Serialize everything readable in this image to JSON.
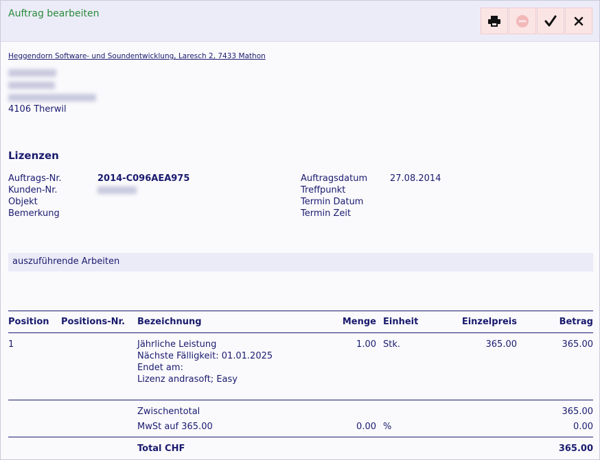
{
  "window": {
    "title": "Auftrag bearbeiten"
  },
  "toolbar": {
    "buttons": [
      {
        "icon": "print-icon"
      },
      {
        "icon": "no-entry-icon"
      },
      {
        "icon": "checkmark-icon"
      },
      {
        "icon": "close-icon"
      }
    ]
  },
  "company": {
    "address_line": "Heggendorn Software- und Soundentwicklung, Laresch 2, 7433 Mathon"
  },
  "recipient": {
    "city": "4106 Therwil"
  },
  "section": {
    "title": "Lizenzen"
  },
  "details": {
    "order_no_label": "Auftrags-Nr.",
    "order_no": "2014-C096AEA975",
    "customer_no_label": "Kunden-Nr.",
    "object_label": "Objekt",
    "remark_label": "Bemerkung",
    "order_date_label": "Auftragsdatum",
    "order_date": "27.08.2014",
    "meeting_point_label": "Treffpunkt",
    "appointment_date_label": "Termin Datum",
    "appointment_time_label": "Termin Zeit"
  },
  "work_band": {
    "label": "auszuführende Arbeiten"
  },
  "table": {
    "headers": {
      "position": "Position",
      "position_no": "Positions-Nr.",
      "description": "Bezeichnung",
      "quantity": "Menge",
      "unit": "Einheit",
      "unit_price": "Einzelpreis",
      "amount": "Betrag"
    },
    "rows": [
      {
        "position": "1",
        "description_lines": [
          "Jährliche Leistung",
          "Nächste Fälligkeit: 01.01.2025",
          "Endet am:",
          "Lizenz andrasoft; Easy"
        ],
        "quantity": "1.00",
        "unit": "Stk.",
        "unit_price": "365.00",
        "amount": "365.00"
      }
    ],
    "subtotal": {
      "label": "Zwischentotal",
      "amount": "365.00"
    },
    "vat": {
      "label": "MwSt auf 365.00",
      "rate": "0.00",
      "unit": "%",
      "amount": "0.00"
    },
    "total": {
      "label": "Total CHF",
      "amount": "365.00"
    }
  }
}
